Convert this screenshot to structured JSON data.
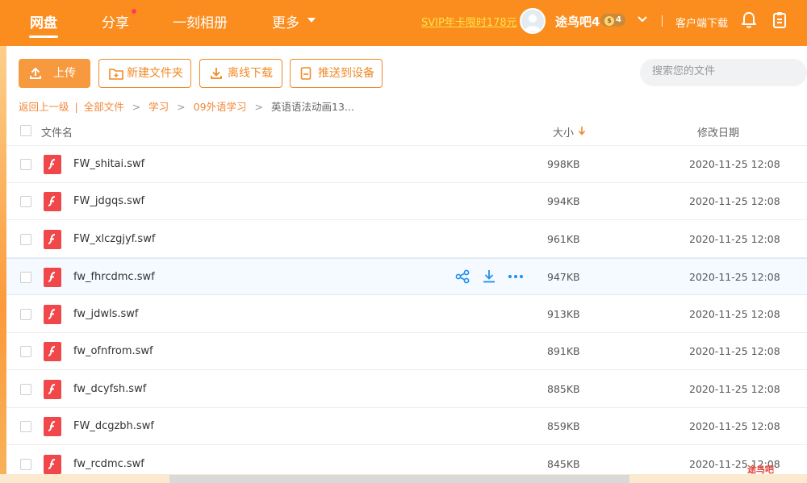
{
  "nav": {
    "items": [
      {
        "label": "网盘"
      },
      {
        "label": "分享"
      },
      {
        "label": "一刻相册"
      },
      {
        "label": "更多"
      }
    ],
    "svip_promo": "SVIP年卡限时178元",
    "username": "途鸟吧4",
    "vip_level": "4",
    "client_download": "客户端下载"
  },
  "toolbar": {
    "upload": "上传",
    "new_folder": "新建文件夹",
    "offline_download": "离线下载",
    "push_to_device": "推送到设备",
    "search_placeholder": "搜索您的文件"
  },
  "breadcrumb": {
    "back": "返回上一级",
    "all_files": "全部文件",
    "path": [
      "学习",
      "09外语学习"
    ],
    "current": "英语语法动画13..."
  },
  "table": {
    "col_name": "文件名",
    "col_size": "大小",
    "col_date": "修改日期",
    "rows": [
      {
        "name": "FW_shitai.swf",
        "size": "998KB",
        "date": "2020-11-25 12:08"
      },
      {
        "name": "FW_jdgqs.swf",
        "size": "994KB",
        "date": "2020-11-25 12:08"
      },
      {
        "name": "FW_xlczgjyf.swf",
        "size": "961KB",
        "date": "2020-11-25 12:08"
      },
      {
        "name": "fw_fhrcdmc.swf",
        "size": "947KB",
        "date": "2020-11-25 12:08"
      },
      {
        "name": "fw_jdwls.swf",
        "size": "913KB",
        "date": "2020-11-25 12:08"
      },
      {
        "name": "fw_ofnfrom.swf",
        "size": "891KB",
        "date": "2020-11-25 12:08"
      },
      {
        "name": "fw_dcyfsh.swf",
        "size": "885KB",
        "date": "2020-11-25 12:08"
      },
      {
        "name": "FW_dcgzbh.swf",
        "size": "859KB",
        "date": "2020-11-25 12:08"
      },
      {
        "name": "fw_rcdmc.swf",
        "size": "845KB",
        "date": "2020-11-25 12:08"
      }
    ]
  },
  "watermark": "途鸟吧",
  "colors": {
    "brand": "#fb8d1e",
    "accent": "#f08a26",
    "action_blue": "#1e8ff0",
    "swf_red": "#f0484a"
  }
}
